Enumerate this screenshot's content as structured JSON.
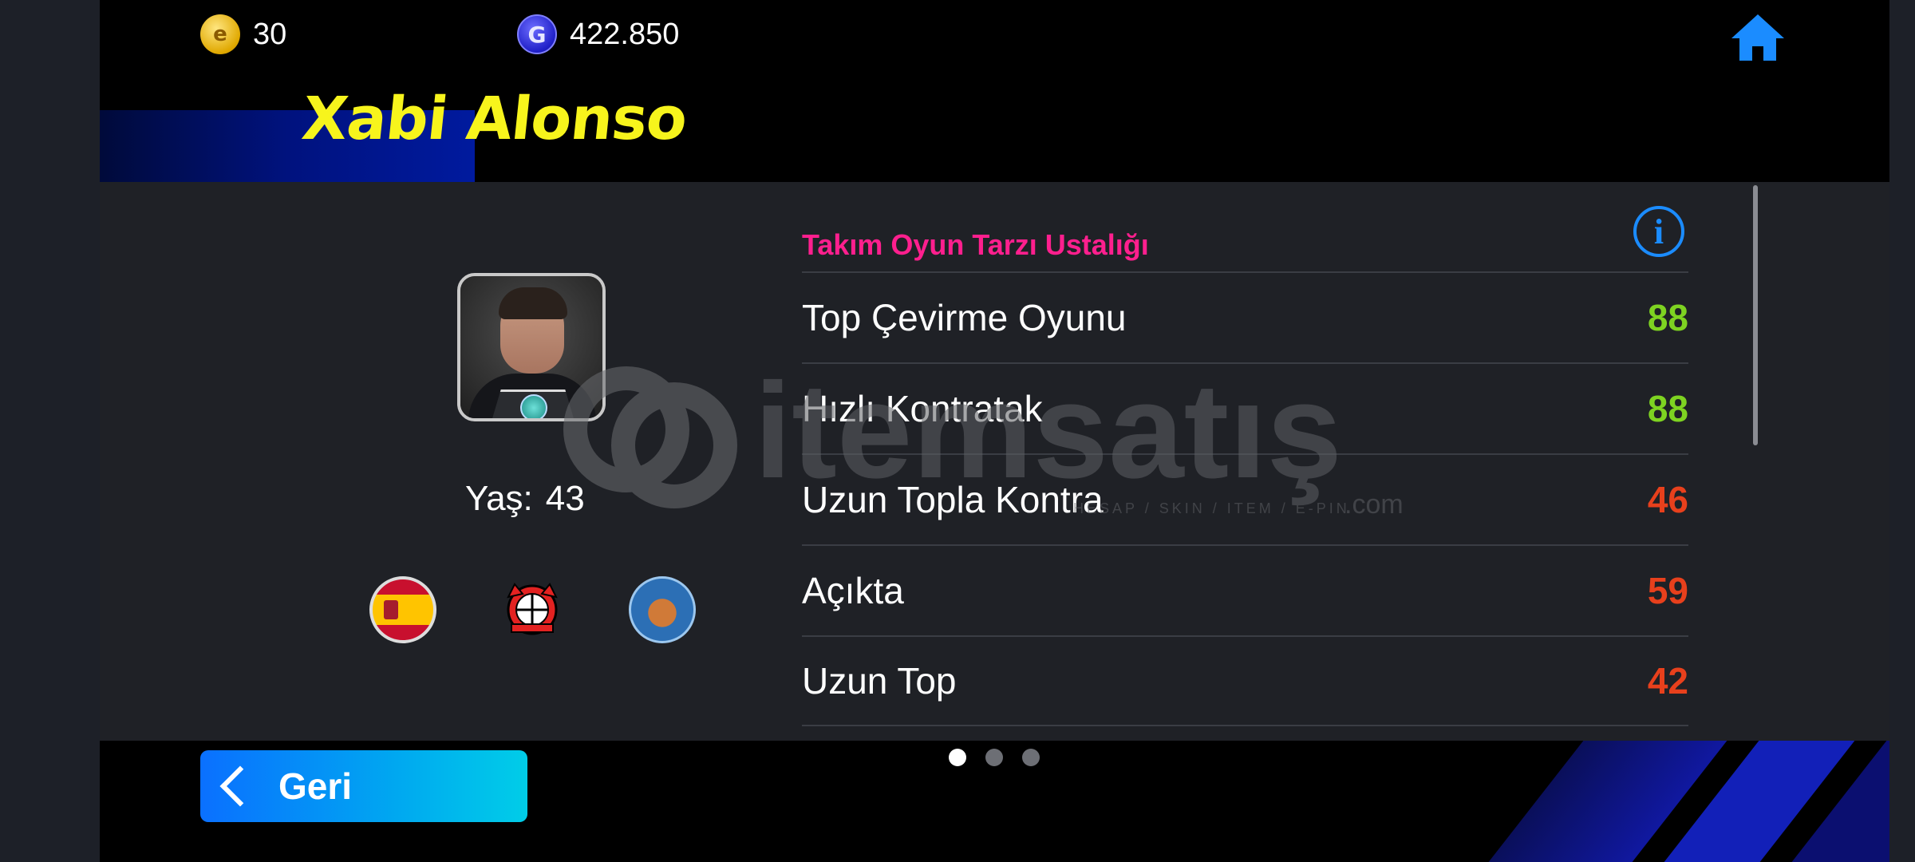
{
  "header": {
    "coins": {
      "icon": "efootball-coin-icon",
      "value": "30"
    },
    "gp": {
      "icon": "gp-coin-icon",
      "value": "422.850"
    },
    "home_icon": "home-icon"
  },
  "player": {
    "name": "Xabi Alonso",
    "age_label": "Yaş:",
    "age_value": "43",
    "badges": [
      "spain-flag-icon",
      "leverkusen-crest-icon",
      "europa-league-icon"
    ]
  },
  "stats": {
    "title": "Takım Oyun Tarzı Ustalığı",
    "info_icon": "info-icon",
    "rows": [
      {
        "label": "Top Çevirme Oyunu",
        "value": "88",
        "color": "#7ed321"
      },
      {
        "label": "Hızlı Kontratak",
        "value": "88",
        "color": "#7ed321"
      },
      {
        "label": "Uzun Topla Kontra",
        "value": "46",
        "color": "#e8401c"
      },
      {
        "label": "Açıkta",
        "value": "59",
        "color": "#e8401c"
      },
      {
        "label": "Uzun Top",
        "value": "42",
        "color": "#e8401c"
      }
    ]
  },
  "watermark": {
    "brand": "itemsatış",
    "tagline": "HESAP / SKIN / ITEM / E-PIN",
    "domain": ".com"
  },
  "footer": {
    "back_label": "Geri",
    "page_count": 3,
    "active_page": 1
  },
  "colors": {
    "name": "#f7f41c",
    "section_title": "#ff1f8e",
    "accent": "#1b8cff"
  }
}
